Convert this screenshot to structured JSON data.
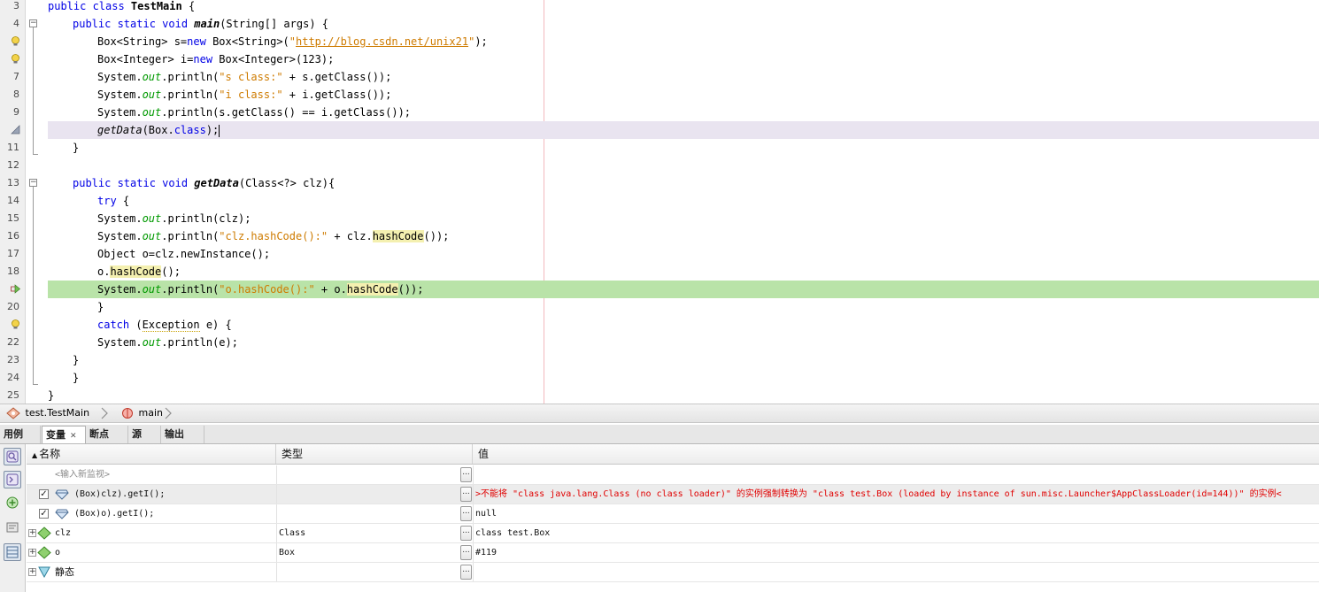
{
  "colors": {
    "accent_link": "#ce7b00",
    "keyword": "#0000e6",
    "field": "#009900",
    "error_text": "#e00000",
    "current_line": "#b9e3a8",
    "caret_line": "#e9e4f0"
  },
  "editor": {
    "line_numbers": [
      "3",
      "4",
      "",
      "",
      "7",
      "8",
      "9",
      "",
      "11",
      "12",
      "13",
      "14",
      "15",
      "16",
      "17",
      "18",
      "",
      "20",
      "",
      "22",
      "23",
      "24",
      "25"
    ],
    "gutter_icons": [
      {
        "line": 2,
        "icon": "hint-bulb-icon"
      },
      {
        "line": 3,
        "icon": "hint-bulb-icon"
      },
      {
        "line": 8,
        "icon": "breakpoint-triangle-icon"
      },
      {
        "line": 17,
        "icon": "current-pc-arrow-icon"
      },
      {
        "line": 19,
        "icon": "hint-bulb-icon"
      }
    ],
    "text": {
      "public_class": "public class ",
      "class_name": "TestMain",
      "brace_open": " {",
      "public_static_void": "public static void ",
      "main": "main",
      "main_params": "(String[] args) {",
      "l4_a": "Box<String> s=",
      "new": "new",
      "l4_b": " Box<String>(",
      "url_open": "\"",
      "url": "http://blog.csdn.net/unix21",
      "url_close": "\"",
      "l4_c": ");",
      "l5_a": "Box<Integer> i=",
      "l5_b": " Box<Integer>(123);",
      "system": "System.",
      "out": "out",
      "println_open": ".println(",
      "s_class_str": "\"s class:\"",
      "plus_s_getclass": " + s.getClass());",
      "i_class_str": "\"i class:\"",
      "plus_i_getclass": " + i.getClass());",
      "l9_rest": "s.getClass() == i.getClass());",
      "getdata_call": "getData",
      "getdata_args_a": "(Box.",
      "class_kw": "class",
      "getdata_args_b": ");",
      "close_brace": "}",
      "getdata_decl": "getData",
      "getdata_params": "(Class<?> clz){",
      "try": "try",
      "try_brace": " {",
      "println_clz": "clz);",
      "hashcode_str": "\"clz.hashCode():\"",
      "plus_clz": " + clz.",
      "hashcode": "hashCode",
      "call_close": "());",
      "l17": "Object o=clz.newInstance();",
      "o_dot": "o.",
      "paren_semi": "();",
      "o_hashcode_str": "\"o.hashCode():\"",
      "plus_o": " + o.",
      "catch": "catch",
      "catch_a": " (",
      "exception": "Exception",
      "catch_b": " e) {",
      "println_e": "e);"
    }
  },
  "breadcrumb": {
    "class_item": "test.TestMain",
    "method_item": "main"
  },
  "tabs": [
    {
      "label": "用例",
      "active": false
    },
    {
      "label": "变量",
      "active": true,
      "close": "✕"
    },
    {
      "label": "断点",
      "active": false
    },
    {
      "label": "源",
      "active": false
    },
    {
      "label": "输出",
      "active": false
    }
  ],
  "variables": {
    "headers": {
      "name": "名称",
      "type": "类型",
      "value": "值",
      "sort_indicator": "▲"
    },
    "new_watch_placeholder": "<输入新监视>",
    "ellipsis": "...",
    "rows": [
      {
        "name": "(Box)clz).getI();",
        "type": "",
        "value": ">不能将 \"class java.lang.Class (no class loader)\" 的实例强制转换为 \"class test.Box (loaded by instance of sun.misc.Launcher$AppClassLoader(id=144))\" 的实例<",
        "checked": true,
        "kind": "watch"
      },
      {
        "name": "(Box)o).getI();",
        "type": "",
        "value": "null",
        "checked": true,
        "kind": "watch"
      },
      {
        "name": "clz",
        "type": "Class",
        "value": "class test.Box",
        "kind": "local"
      },
      {
        "name": "o",
        "type": "Box",
        "value": "#119",
        "kind": "local"
      },
      {
        "name": "静态",
        "type": "",
        "value": "",
        "kind": "static"
      }
    ],
    "check_mark": "✓",
    "expand_mark": "+"
  }
}
